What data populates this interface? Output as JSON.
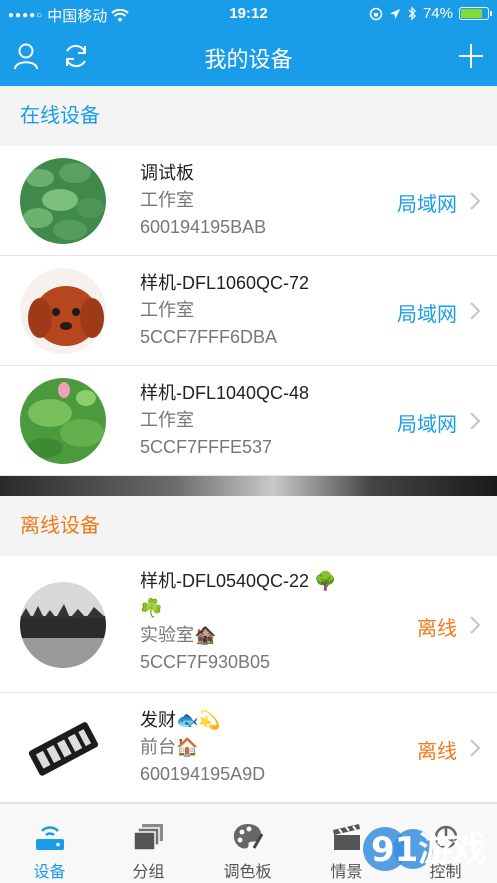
{
  "status_bar": {
    "carrier": "中国移动",
    "time": "19:12",
    "battery_percent": "74%",
    "battery_level": 0.74
  },
  "nav": {
    "title": "我的设备",
    "left_icons": [
      "user-icon",
      "refresh-icon"
    ],
    "right_icon": "plus-icon"
  },
  "sections": {
    "online_title": "在线设备",
    "offline_title": "离线设备"
  },
  "online_devices": [
    {
      "name": "调试板",
      "location": "工作室",
      "id": "600194195BAB",
      "status": "局域网",
      "avatar": "lotus-leaves"
    },
    {
      "name": "样机-DFL1060QC-72",
      "location": "工作室",
      "id": "5CCF7FFF6DBA",
      "status": "局域网",
      "avatar": "puppy"
    },
    {
      "name": "样机-DFL1040QC-48",
      "location": "工作室",
      "id": "5CCF7FFFE537",
      "status": "局域网",
      "avatar": "lotus-flower"
    }
  ],
  "offline_devices": [
    {
      "name": "样机-DFL0540QC-22 🌳",
      "name_line2": "☘️",
      "location": "实验室🏚️",
      "id": "5CCF7F930B05",
      "status": "离线",
      "avatar": "forest-bw"
    },
    {
      "name": "发财🐟💫",
      "location": "前台🏠",
      "id": "600194195A9D",
      "status": "离线",
      "avatar": "device-box"
    }
  ],
  "tabs": [
    {
      "label": "设备",
      "icon": "router-icon",
      "active": true
    },
    {
      "label": "分组",
      "icon": "stack-icon",
      "active": false
    },
    {
      "label": "调色板",
      "icon": "palette-icon",
      "active": false
    },
    {
      "label": "情景",
      "icon": "clapper-icon",
      "active": false
    },
    {
      "label": "控制",
      "icon": "control-icon",
      "active": false
    }
  ],
  "watermark": "91游戏",
  "colors": {
    "primary": "#1a9de8",
    "offline": "#ef7a1a"
  }
}
